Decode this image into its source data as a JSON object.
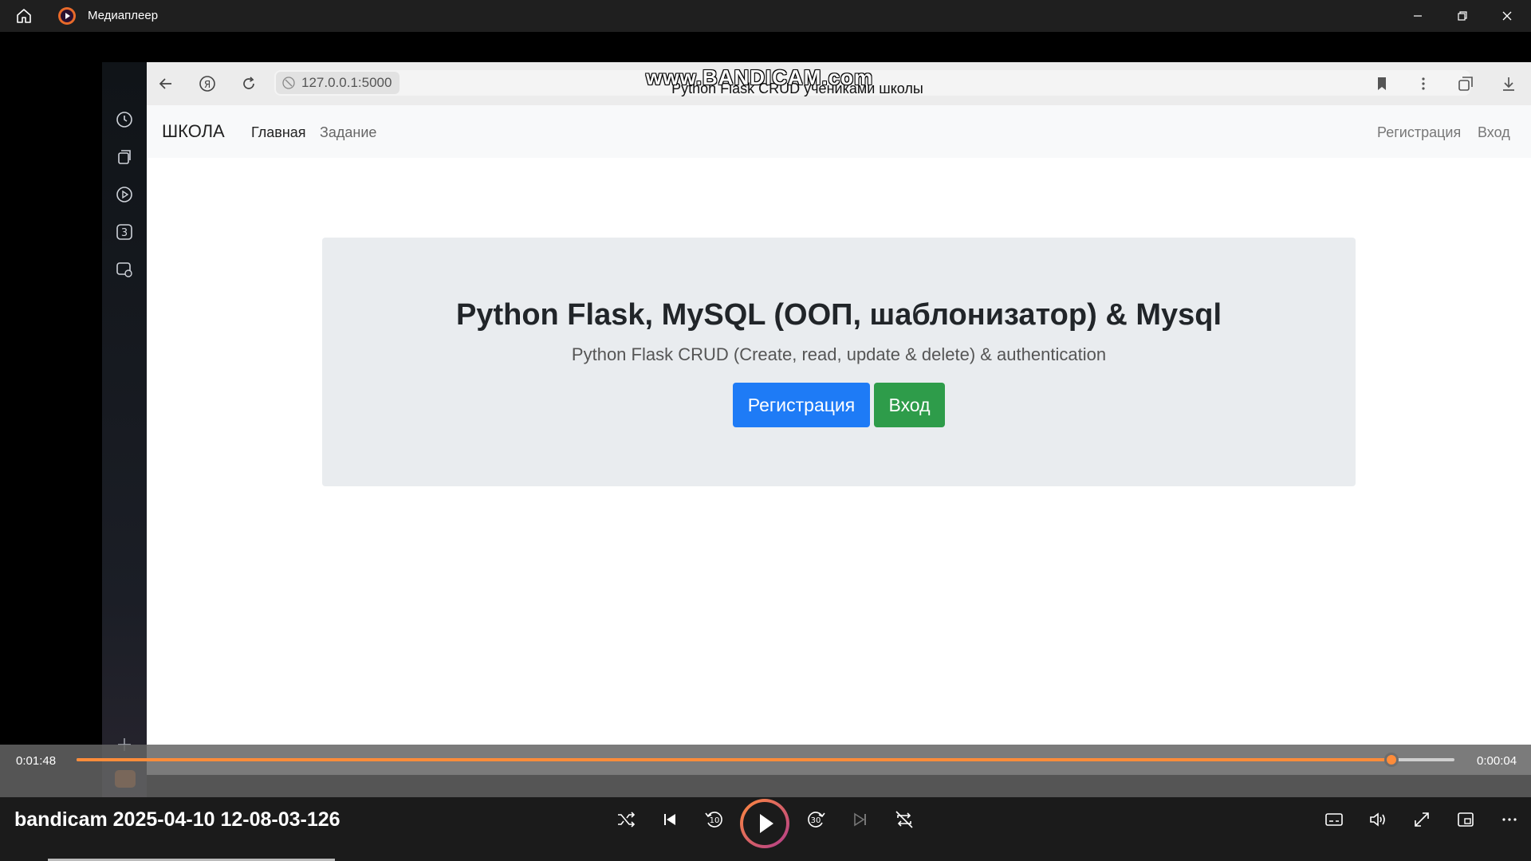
{
  "titlebar": {
    "app_title": "Медиаплеер"
  },
  "browser": {
    "url": "127.0.0.1:5000",
    "page_title": "Python Flask CRUD учениками школы",
    "watermark": "www.BANDICAM.com"
  },
  "site": {
    "brand": "ШКОЛА",
    "nav_left": [
      "Главная",
      "Задание"
    ],
    "nav_right": [
      "Регистрация",
      "Вход"
    ],
    "jumbotron": {
      "heading": "Python Flask, MySQL (ООП, шаблонизатор) & Mysql",
      "lead": "Python Flask CRUD (Create, read, update & delete) & authentication",
      "register_button": "Регистрация",
      "login_button": "Вход"
    }
  },
  "player": {
    "elapsed": "0:01:48",
    "remaining": "0:00:04",
    "progress_fraction": 0.954,
    "file_title": "bandicam 2025-04-10 12-08-03-126",
    "accent_color": "#ff8c3a"
  }
}
